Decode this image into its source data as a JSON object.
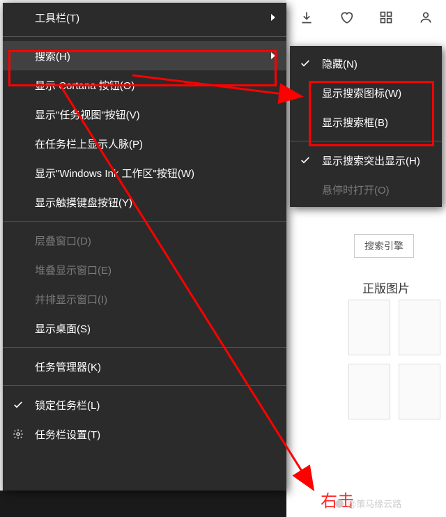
{
  "mainMenu": {
    "items": [
      {
        "label": "工具栏(T)",
        "hasSub": true
      },
      {
        "label": "搜索(H)",
        "hasSub": true,
        "hover": true
      },
      {
        "label": "显示 Cortana 按钮(O)"
      },
      {
        "label": "显示\"任务视图\"按钮(V)"
      },
      {
        "label": "在任务栏上显示人脉(P)"
      },
      {
        "label": "显示\"Windows Ink 工作区\"按钮(W)"
      },
      {
        "label": "显示触摸键盘按钮(Y)"
      },
      {
        "label": "层叠窗口(D)",
        "disabled": true
      },
      {
        "label": "堆叠显示窗口(E)",
        "disabled": true
      },
      {
        "label": "并排显示窗口(I)",
        "disabled": true
      },
      {
        "label": "显示桌面(S)"
      },
      {
        "label": "任务管理器(K)"
      },
      {
        "label": "锁定任务栏(L)",
        "checked": true
      },
      {
        "label": "任务栏设置(T)",
        "gear": true
      }
    ],
    "separatorsAfter": [
      0,
      6,
      10,
      11
    ]
  },
  "subMenu": {
    "items": [
      {
        "label": "隐藏(N)",
        "checked": true
      },
      {
        "label": "显示搜索图标(W)"
      },
      {
        "label": "显示搜索框(B)"
      },
      {
        "label": "显示搜索突出显示(H)",
        "checked": true
      },
      {
        "label": "悬停时打开(O)",
        "disabled": true
      }
    ],
    "separatorsAfter": [
      2
    ]
  },
  "rightPanel": {
    "pill": "搜索引擎",
    "heading": "正版图片"
  },
  "annotation": {
    "rightClickText": "右击"
  },
  "watermark": "@策马缘云路"
}
